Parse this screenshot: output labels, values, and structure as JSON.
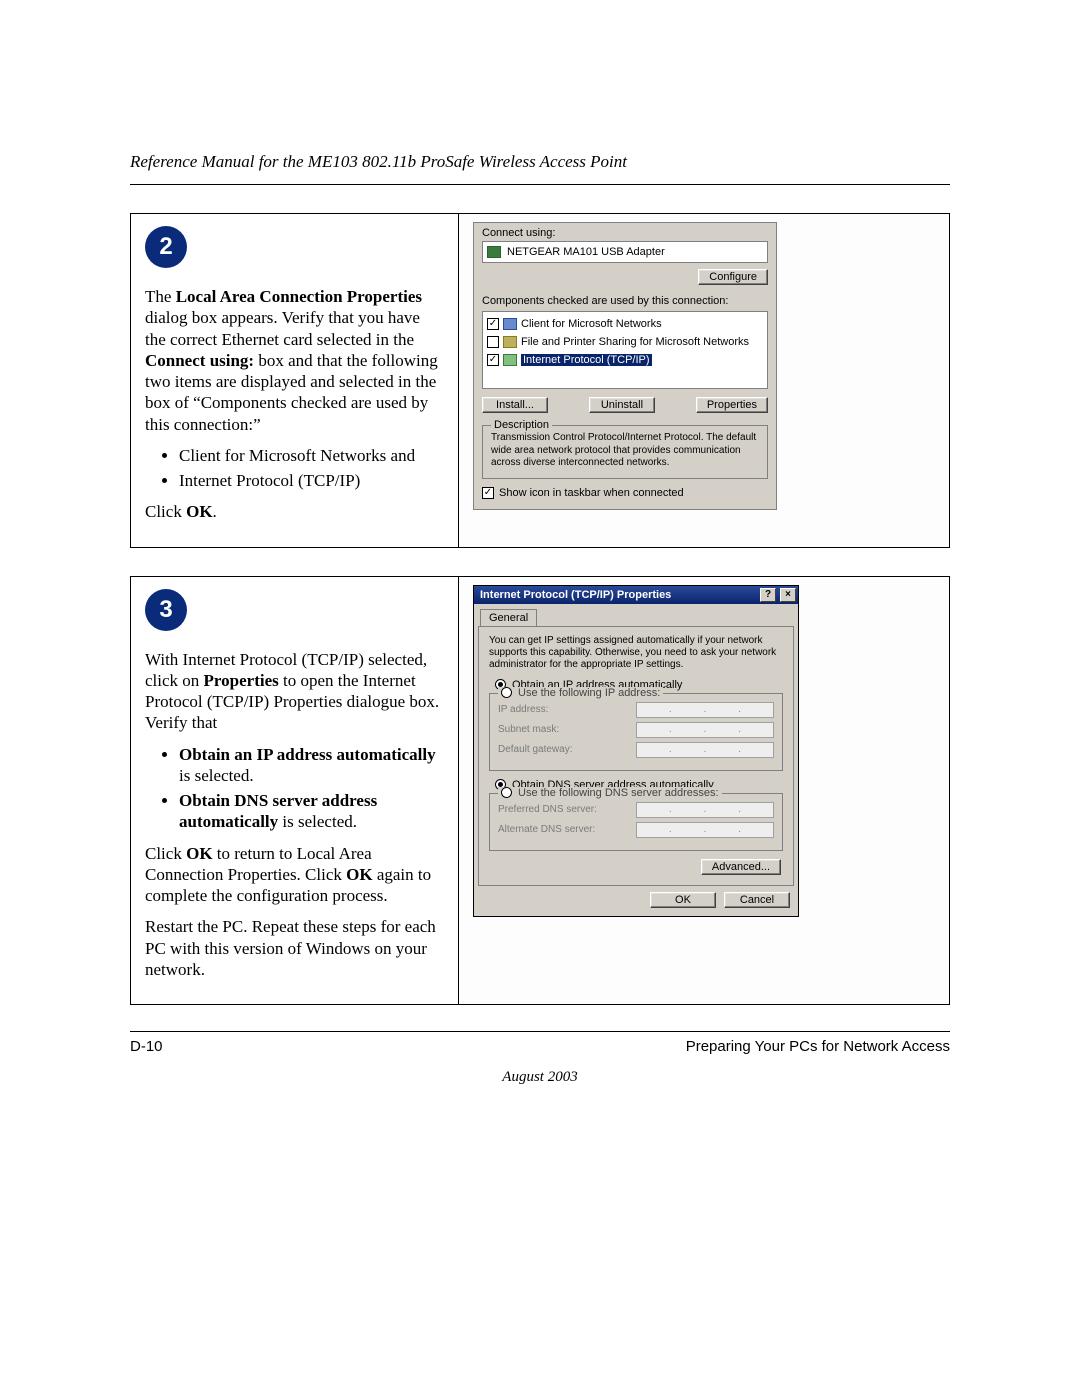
{
  "header": {
    "title": "Reference Manual for the ME103 802.11b ProSafe Wireless Access Point"
  },
  "steps": {
    "s2": {
      "badge": "2",
      "p1_a": "The ",
      "p1_b": "Local Area Connection Properties",
      "p1_c": " dialog box appears.  Verify that you have the correct Ethernet card selected in the ",
      "p1_d": "Connect using:",
      "p1_e": " box and that the following two items are displayed and selected in the box of “Components checked are used by this connection:”",
      "bullets": {
        "b1": "Client for Microsoft Networks and",
        "b2": "Internet Protocol (TCP/IP)"
      },
      "p2_a": "Click ",
      "p2_b": "OK",
      "p2_c": "."
    },
    "s3": {
      "badge": "3",
      "p1_a": "With Internet Protocol (TCP/IP) selected, click on ",
      "p1_b": "Properties",
      "p1_c": " to open the Internet Protocol (TCP/IP) Properties dialogue box. Verify that",
      "bullets": {
        "b1_a": "Obtain an IP address automatically",
        "b1_b": " is selected.",
        "b2_a": "Obtain DNS server address automatically",
        "b2_b": " is selected."
      },
      "p2_a": "Click ",
      "p2_b": "OK",
      "p2_c": " to return to Local Area Connection Properties. Click ",
      "p2_d": "OK",
      "p2_e": " again to complete the configuration process.",
      "p3": "Restart the PC. Repeat these steps for each PC with this version of Windows on your network."
    }
  },
  "shot1": {
    "connect_label": "Connect using:",
    "adapter": "NETGEAR MA101 USB Adapter",
    "configure_btn": "Configure",
    "comps_label": "Components checked are used by this connection:",
    "items": {
      "c1": "Client for Microsoft Networks",
      "c2": "File and Printer Sharing for Microsoft Networks",
      "c3": "Internet Protocol (TCP/IP)"
    },
    "install_btn": "Install...",
    "uninstall_btn": "Uninstall",
    "properties_btn": "Properties",
    "desc_legend": "Description",
    "desc_text": "Transmission Control Protocol/Internet Protocol. The default wide area network protocol that provides communication across diverse interconnected networks.",
    "show_icon": "Show icon in taskbar when connected"
  },
  "shot2": {
    "title": "Internet Protocol (TCP/IP) Properties",
    "help_btn": "?",
    "close_btn": "×",
    "tab": "General",
    "intro": "You can get IP settings assigned automatically if your network supports this capability. Otherwise, you need to ask your network administrator for the appropriate IP settings.",
    "r1": "Obtain an IP address automatically",
    "r2": "Use the following IP address:",
    "ip_label": "IP address:",
    "subnet_label": "Subnet mask:",
    "gateway_label": "Default gateway:",
    "r3": "Obtain DNS server address automatically",
    "r4": "Use the following DNS server addresses:",
    "pdns_label": "Preferred DNS server:",
    "adns_label": "Alternate DNS server:",
    "advanced_btn": "Advanced...",
    "ok_btn": "OK",
    "cancel_btn": "Cancel"
  },
  "footer": {
    "page_no": "D-10",
    "section": "Preparing Your PCs for Network Access",
    "date": "August 2003"
  }
}
